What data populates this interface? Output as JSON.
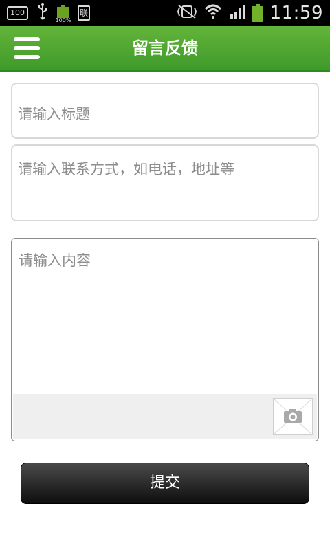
{
  "status_bar": {
    "left_box_text": "100",
    "battery_small_text": "100%",
    "doc_icon_text": "联",
    "time": "11:59",
    "icons": [
      "usb-icon",
      "battery-icon",
      "sim-icon",
      "vibrate-icon",
      "wifi-icon",
      "signal-icon",
      "battery-icon"
    ]
  },
  "header": {
    "title": "留言反馈",
    "menu_icon": "menu-icon",
    "bg_color": "#4aa431"
  },
  "form": {
    "title_placeholder": "请输入标题",
    "contact_placeholder": "请输入联系方式，如电话，地址等",
    "content_placeholder": "请输入内容",
    "camera_icon": "camera-icon"
  },
  "submit": {
    "label": "提交"
  }
}
